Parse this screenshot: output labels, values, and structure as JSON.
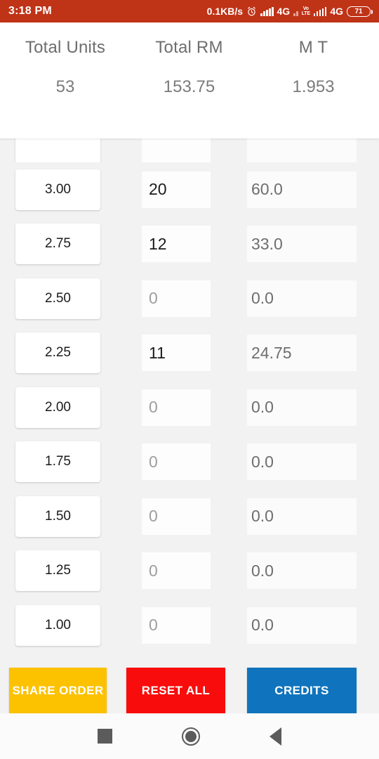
{
  "status_bar": {
    "time": "3:18 PM",
    "network_speed": "0.1KB/s",
    "alarm_icon": "alarm-clock-icon",
    "sim1_signal_icon": "signal-bars-icon",
    "sim1_network": "4G",
    "volte_top": "Vo",
    "volte_bottom": "LTE",
    "sim2_signal_icon": "signal-bars-icon",
    "sim2_network": "4G",
    "battery_percent": "71",
    "background_color": "#bf3317"
  },
  "summary": {
    "columns": [
      {
        "label": "Total Units",
        "value": "53"
      },
      {
        "label": "Total RM",
        "value": "153.75"
      },
      {
        "label": "M T",
        "value": "1.953"
      }
    ]
  },
  "order_rows": [
    {
      "price": "3.00",
      "qty": "20",
      "qty_is_placeholder": false,
      "total": "60.0"
    },
    {
      "price": "2.75",
      "qty": "12",
      "qty_is_placeholder": false,
      "total": "33.0"
    },
    {
      "price": "2.50",
      "qty": "0",
      "qty_is_placeholder": true,
      "total": "0.0"
    },
    {
      "price": "2.25",
      "qty": "11",
      "qty_is_placeholder": false,
      "total": "24.75"
    },
    {
      "price": "2.00",
      "qty": "0",
      "qty_is_placeholder": true,
      "total": "0.0"
    },
    {
      "price": "1.75",
      "qty": "0",
      "qty_is_placeholder": true,
      "total": "0.0"
    },
    {
      "price": "1.50",
      "qty": "0",
      "qty_is_placeholder": true,
      "total": "0.0"
    },
    {
      "price": "1.25",
      "qty": "0",
      "qty_is_placeholder": true,
      "total": "0.0"
    },
    {
      "price": "1.00",
      "qty": "0",
      "qty_is_placeholder": true,
      "total": "0.0"
    }
  ],
  "actions": {
    "share_label": "SHARE ORDER",
    "reset_label": "RESET ALL",
    "credits_label": "CREDITS",
    "share_color": "#fcc200",
    "reset_color": "#f80c0c",
    "credits_color": "#0f74bd"
  },
  "nav_bar": {
    "recents_icon": "square-recents-icon",
    "home_icon": "circle-home-icon",
    "back_icon": "triangle-back-icon"
  }
}
